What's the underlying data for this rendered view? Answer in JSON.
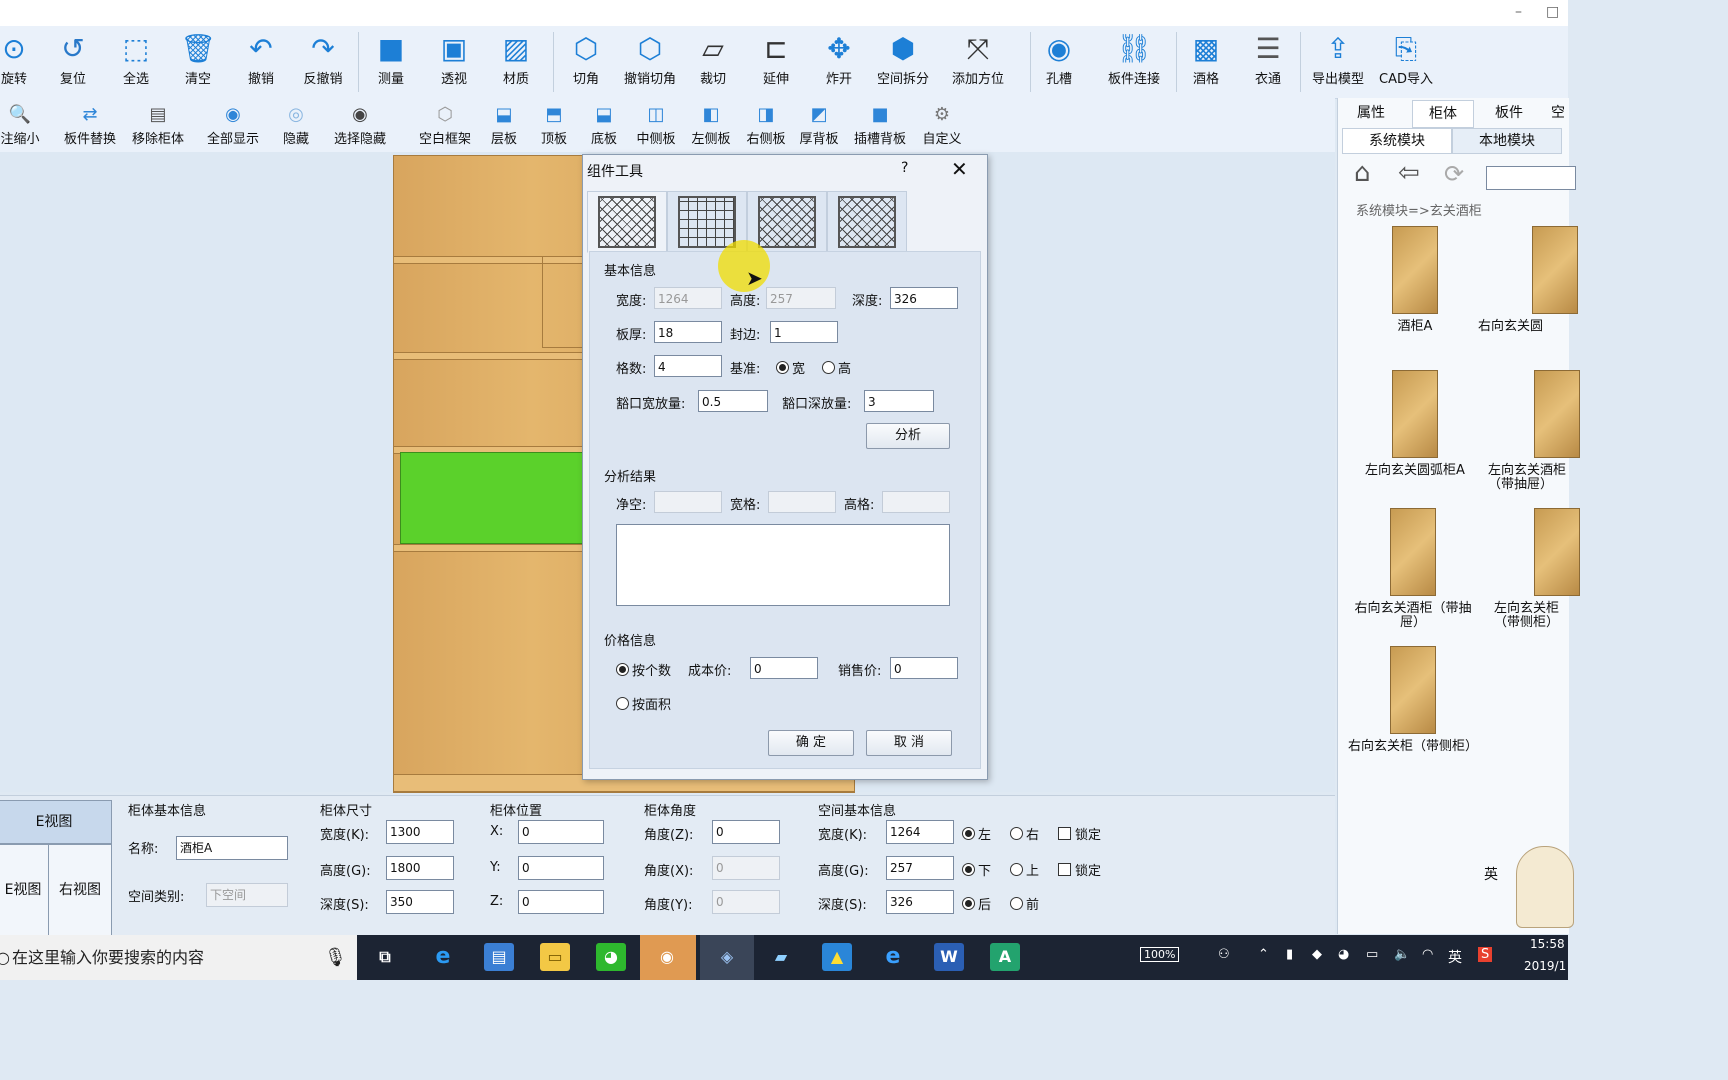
{
  "window_controls": {
    "minimize": "–",
    "maximize": "□"
  },
  "toolbar1": [
    {
      "label": "旋转",
      "icon": "rotate-icon"
    },
    {
      "label": "复位",
      "icon": "reset-icon"
    },
    {
      "label": "全选",
      "icon": "select-all-icon"
    },
    {
      "label": "清空",
      "icon": "trash-icon"
    },
    {
      "label": "撤销",
      "icon": "undo-icon"
    },
    {
      "label": "反撤销",
      "icon": "redo-icon"
    },
    {
      "label": "测量",
      "icon": "measure-icon"
    },
    {
      "label": "透视",
      "icon": "perspective-icon"
    },
    {
      "label": "材质",
      "icon": "material-icon"
    },
    {
      "label": "切角",
      "icon": "chamfer-icon"
    },
    {
      "label": "撤销切角",
      "icon": "undo-chamfer-icon"
    },
    {
      "label": "裁切",
      "icon": "cut-icon"
    },
    {
      "label": "延伸",
      "icon": "extend-icon"
    },
    {
      "label": "炸开",
      "icon": "explode-icon"
    },
    {
      "label": "空间拆分",
      "icon": "space-split-icon"
    },
    {
      "label": "添加方位",
      "icon": "add-orientation-icon"
    },
    {
      "label": "孔槽",
      "icon": "hole-slot-icon"
    },
    {
      "label": "板件连接",
      "icon": "panel-link-icon"
    },
    {
      "label": "酒格",
      "icon": "wine-grid-icon"
    },
    {
      "label": "衣通",
      "icon": "hanger-rod-icon"
    },
    {
      "label": "导出模型",
      "icon": "export-model-icon"
    },
    {
      "label": "CAD导入",
      "icon": "cad-import-icon"
    }
  ],
  "toolbar2": [
    {
      "label": "注缩小",
      "icon": "zoom-out-icon"
    },
    {
      "label": "板件替换",
      "icon": "panel-replace-icon"
    },
    {
      "label": "移除柜体",
      "icon": "remove-cabinet-icon"
    },
    {
      "label": "全部显示",
      "icon": "show-all-icon"
    },
    {
      "label": "隐藏",
      "icon": "hide-icon"
    },
    {
      "label": "选择隐藏",
      "icon": "select-hide-icon"
    },
    {
      "label": "空白框架",
      "icon": "blank-frame-icon"
    },
    {
      "label": "层板",
      "icon": "shelf-icon"
    },
    {
      "label": "顶板",
      "icon": "top-panel-icon"
    },
    {
      "label": "底板",
      "icon": "bottom-panel-icon"
    },
    {
      "label": "中侧板",
      "icon": "middle-side-icon"
    },
    {
      "label": "左侧板",
      "icon": "left-side-icon"
    },
    {
      "label": "右侧板",
      "icon": "right-side-icon"
    },
    {
      "label": "厚背板",
      "icon": "thick-back-icon"
    },
    {
      "label": "插槽背板",
      "icon": "slot-back-icon"
    },
    {
      "label": "自定义",
      "icon": "custom-icon"
    }
  ],
  "dialog": {
    "title": "组件工具",
    "help": "?",
    "close": "✕",
    "basic_title": "基本信息",
    "width_label": "宽度:",
    "width_value": "1264",
    "height_label": "高度:",
    "height_value": "257",
    "depth_label": "深度:",
    "depth_value": "326",
    "thickness_label": "板厚:",
    "thickness_value": "18",
    "edge_label": "封边:",
    "edge_value": "1",
    "grid_count_label": "格数:",
    "grid_count_value": "4",
    "basis_label": "基准:",
    "basis_width": "宽",
    "basis_height": "高",
    "notch_width_label": "豁口宽放量:",
    "notch_width_value": "0.5",
    "notch_depth_label": "豁口深放量:",
    "notch_depth_value": "3",
    "analyze_button": "分析",
    "result_title": "分析结果",
    "clear_label": "净空:",
    "width_grid_label": "宽格:",
    "height_grid_label": "高格:",
    "price_title": "价格信息",
    "by_count": "按个数",
    "by_area": "按面积",
    "cost_label": "成本价:",
    "cost_value": "0",
    "sale_label": "销售价:",
    "sale_value": "0",
    "ok_button": "确 定",
    "cancel_button": "取 消"
  },
  "right_panel": {
    "tabs": [
      "属性",
      "柜体",
      "板件",
      "空"
    ],
    "subtabs": [
      "系统模块",
      "本地模块"
    ],
    "path": "系统模块=>玄关酒柜",
    "modules": [
      {
        "name": "酒柜A"
      },
      {
        "name": "右向玄关圆"
      },
      {
        "name": "左向玄关圆弧柜A"
      },
      {
        "name": "左向玄关酒柜（带抽屉）"
      },
      {
        "name": "右向玄关酒柜（带抽屉）"
      },
      {
        "name": "左向玄关柜（带侧柜）"
      },
      {
        "name": "右向玄关柜（带侧柜）"
      }
    ]
  },
  "bottom_panel": {
    "views": {
      "front": "E视图",
      "left": "E视图",
      "right": "右视图"
    },
    "basic_title": "柜体基本信息",
    "name_label": "名称:",
    "name_value": "酒柜A",
    "space_type_label": "空间类别:",
    "space_type_value": "下空间",
    "size_title": "柜体尺寸",
    "w_label": "宽度(K):",
    "w_value": "1300",
    "h_label": "高度(G):",
    "h_value": "1800",
    "d_label": "深度(S):",
    "d_value": "350",
    "pos_title": "柜体位置",
    "x_label": "X:",
    "x_value": "0",
    "y_label": "Y:",
    "y_value": "0",
    "z_label": "Z:",
    "z_value": "0",
    "angle_title": "柜体角度",
    "az_label": "角度(Z):",
    "az_value": "0",
    "ax_label": "角度(X):",
    "ax_value": "0",
    "ay_label": "角度(Y):",
    "ay_value": "0",
    "space_title": "空间基本信息",
    "sw_label": "宽度(K):",
    "sw_value": "1264",
    "sh_label": "高度(G):",
    "sh_value": "257",
    "sd_label": "深度(S):",
    "sd_value": "326",
    "left": "左",
    "right": "右",
    "down": "下",
    "up": "上",
    "back": "后",
    "front": "前",
    "lock": "锁定"
  },
  "taskbar": {
    "search_placeholder": "在这里输入你要搜索的内容",
    "battery": "100%",
    "ime": "英",
    "time": "15:58",
    "date": "2019/1"
  }
}
